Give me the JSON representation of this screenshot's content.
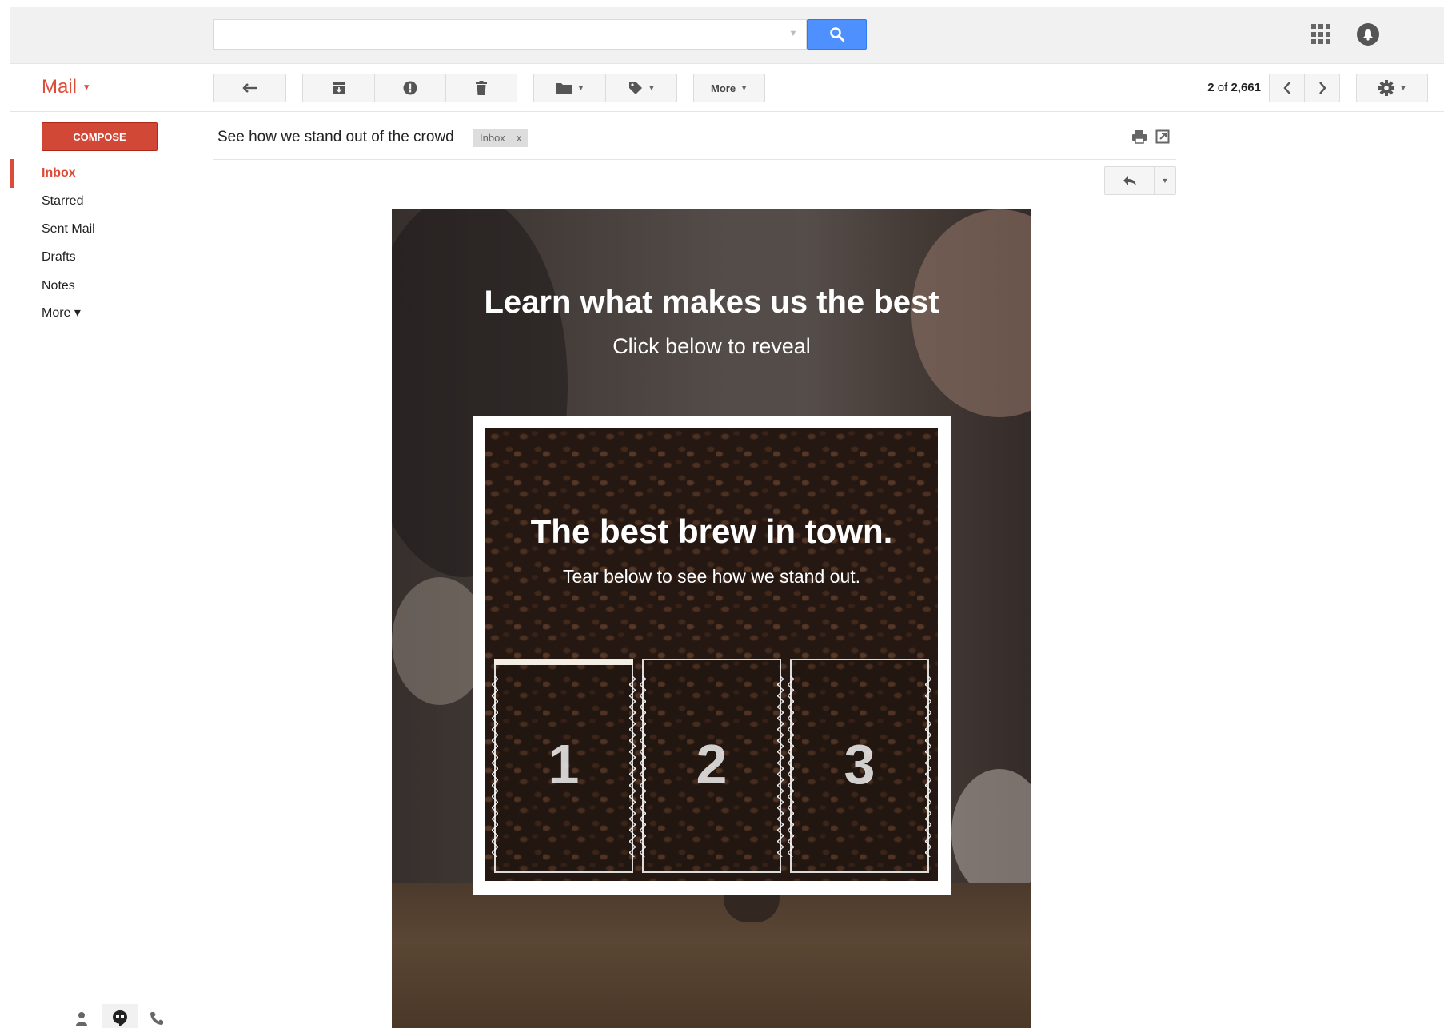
{
  "app": {
    "mail_label": "Mail",
    "compose_label": "COMPOSE"
  },
  "search": {
    "value": "",
    "placeholder": ""
  },
  "toolbar": {
    "more_label": "More",
    "pager_current": "2",
    "pager_of": " of ",
    "pager_total": "2,661"
  },
  "sidebar": {
    "items": [
      {
        "label": "Inbox",
        "selected": true
      },
      {
        "label": "Starred"
      },
      {
        "label": "Sent Mail"
      },
      {
        "label": "Drafts"
      },
      {
        "label": "Notes"
      },
      {
        "label": "More ▾"
      }
    ]
  },
  "message": {
    "subject": "See how we stand out of the crowd",
    "label_chip": "Inbox",
    "label_chip_close": "x"
  },
  "email": {
    "hero_title": "Learn what makes us the best",
    "hero_subtitle": "Click below to reveal",
    "card_title": "The best brew in town.",
    "card_subtitle": "Tear below to see how we stand out.",
    "tickets": [
      "1",
      "2",
      "3"
    ]
  },
  "icons": {
    "search": "search-icon",
    "apps": "apps-grid-icon",
    "notifications": "notifications-icon",
    "reply": "reply-icon",
    "archive": "archive-icon",
    "spam": "report-spam-icon",
    "delete": "trash-icon",
    "move": "folder-icon",
    "labels": "tag-icon",
    "prev": "chevron-left-icon",
    "next": "chevron-right-icon",
    "settings": "gear-icon",
    "print": "print-icon",
    "new_window": "new-window-icon",
    "contacts": "person-icon",
    "hangouts": "hangouts-icon",
    "phone": "phone-icon"
  },
  "colors": {
    "brand_red": "#dd4b39",
    "compose_red": "#d14836",
    "search_blue": "#4d90fe"
  }
}
